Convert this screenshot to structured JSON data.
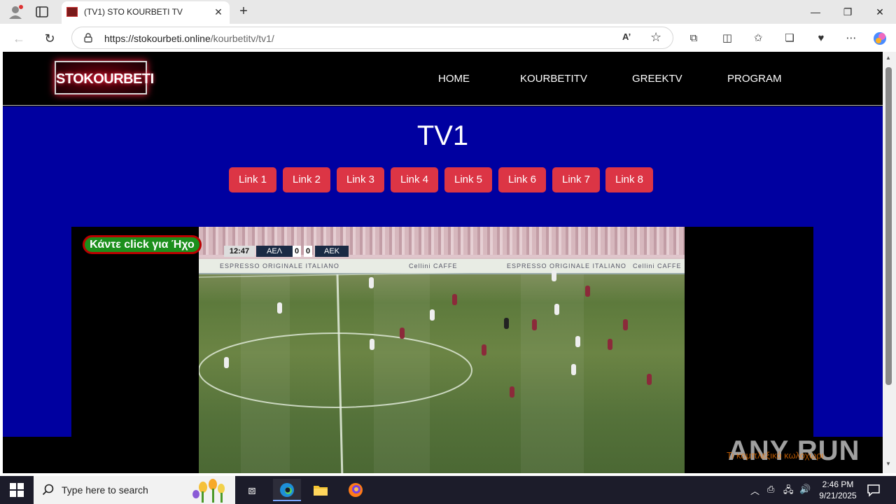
{
  "browser": {
    "tab_title": "(TV1) STO KOURBETI TV",
    "tab_close": "✕",
    "new_tab": "+",
    "url_host": "https://stokourbeti.online",
    "url_path": "/kourbetitv/tv1/",
    "read_aloud": "A’",
    "favorite_star": "☆",
    "window": {
      "minimize": "—",
      "restore": "❐",
      "close": "✕"
    }
  },
  "site": {
    "logo": "STOKOURBETI",
    "menu": [
      "HOME",
      "KOURBETITV",
      "GREEKTV",
      "PROGRAM"
    ],
    "page_title": "TV1",
    "links": [
      "Link 1",
      "Link 2",
      "Link 3",
      "Link 4",
      "Link 5",
      "Link 6",
      "Link 7",
      "Link 8"
    ],
    "sound_button": "Κάντε click για Ήχο",
    "scoreboard": {
      "time": "12:47",
      "home": "ΑΕΛ",
      "home_score": "0",
      "away_score": "0",
      "away": "ΑΕΚ"
    },
    "ad_board": [
      "ESPRESSO ORIGINALE ITALIANO",
      "Cellini CAFFE",
      "ESPRESSO ORIGINALE ITALIANO",
      "Cellini CAFFE"
    ],
    "ticker": "Τι κομπλεξικό κωλοχωρι",
    "watermark": "ANY RUN"
  },
  "taskbar": {
    "search_placeholder": "Type here to search",
    "time": "2:46 PM",
    "date": "9/21/2025"
  },
  "colors": {
    "page_blue": "#0000a0",
    "link_red": "#dc3545",
    "sound_green": "#1b8f1b"
  }
}
